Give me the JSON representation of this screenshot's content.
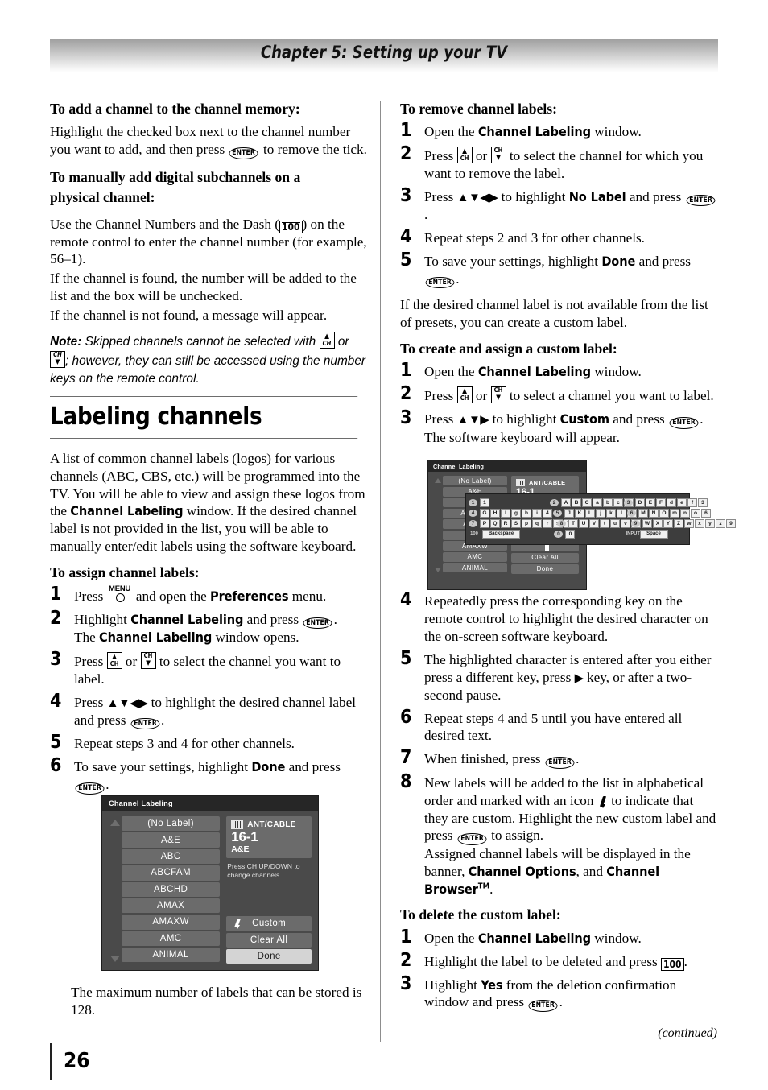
{
  "header": {
    "chapter_title": "Chapter 5: Setting up your TV"
  },
  "footer": {
    "continued": "(continued)",
    "page_number": "26"
  },
  "left_column": {
    "heading_add_channel": "To add a channel to the channel memory:",
    "para_add_channel_1": "Highlight the checked box next to the channel number",
    "para_add_channel_2": "you want to add, and then press",
    "para_add_channel_3": "to remove the tick.",
    "heading_manual_1": "To manually add digital subchannels on a",
    "heading_manual_2": "physical channel:",
    "para_manual_1": "Use the Channel Numbers and the Dash (",
    "para_manual_2": ") on",
    "para_manual_3": "the remote control to enter the channel number (for",
    "para_manual_4": "example, 56–1).",
    "para_manual_5": "If the channel is found, the number will be added to",
    "para_manual_6": "the list and the box will be unchecked.",
    "para_manual_7": "If the channel is not found, a message will appear.",
    "note_label": "Note:",
    "note_text_1": "Skipped channels cannot be selected with",
    "note_text_2": "or",
    "note_text_3": "; however, they can still be accessed",
    "note_text_4": "using the number keys on the remote control.",
    "section_title": "Labeling channels",
    "para_intro_1": "A list of common channel labels (logos) for various",
    "para_intro_2": "channels (ABC, CBS, etc.) will be programmed into",
    "para_intro_3": "the TV. You will be able to view and assign these",
    "para_intro_4": "logos from the",
    "para_intro_5": "window. If the",
    "para_intro_6": "desired channel label is not provided in the list, you",
    "para_intro_7": "will be able to manually enter/edit labels using the",
    "para_intro_8": "software keyboard.",
    "heading_assign": "To assign channel labels:",
    "assign_steps": [
      {
        "num": "1",
        "t1": "Press",
        "t2": "and open the",
        "bold": "Preferences",
        "t3": "menu."
      },
      {
        "num": "2",
        "t1": "Highlight",
        "bold": "Channel Labeling",
        "t2": "and press",
        "t3": ".",
        "l2a": "The",
        "l2bold": "Channel Labeling",
        "l2b": "window opens."
      },
      {
        "num": "3",
        "t1": "Press",
        "t2": "or",
        "t3": "to select the channel you want to",
        "t4": "label."
      },
      {
        "num": "4",
        "t1": "Press",
        "arrows": "▲▼◀▶",
        "t2": "to highlight the desired channel",
        "t3": "label and press",
        "t4": "."
      },
      {
        "num": "5",
        "t1": "Repeat steps 3 and 4 for other channels."
      },
      {
        "num": "6",
        "t1": "To save your settings, highlight",
        "bold": "Done",
        "t2": "and press",
        "t3": "."
      }
    ],
    "osd_caption_1": "The maximum number of labels that can be stored",
    "osd_caption_2": "is 128."
  },
  "right_column": {
    "heading_remove": "To remove channel labels:",
    "remove_steps": [
      {
        "num": "1",
        "t1": "Open the",
        "bold": "Channel Labeling",
        "t2": "window."
      },
      {
        "num": "2",
        "t1": "Press",
        "t2": "or",
        "t3": "to select the channel for which",
        "t4": "you want to remove the label."
      },
      {
        "num": "3",
        "t1": "Press",
        "arrows": "▲▼◀▶",
        "t2": "to highlight",
        "bold": "No Label",
        "t3": "and press",
        "t4": "."
      },
      {
        "num": "4",
        "t1": "Repeat steps 2 and 3 for other channels."
      },
      {
        "num": "5",
        "t1": "To save your settings, highlight",
        "bold": "Done",
        "t2": "and press",
        "t3": "."
      }
    ],
    "para_presets_1": "If the desired channel label is not available from the",
    "para_presets_2": "list of presets, you can create a custom label.",
    "heading_create": "To create and assign a custom label:",
    "create_steps": [
      {
        "num": "1",
        "t1": "Open the",
        "bold": "Channel Labeling",
        "t2": "window."
      },
      {
        "num": "2",
        "t1": "Press",
        "t2": "or",
        "t3": "to select a channel you want to",
        "t4": "label."
      },
      {
        "num": "3",
        "t1": "Press",
        "arrows": "▲▼▶",
        "t2": "to highlight",
        "bold": "Custom",
        "t3": "and press",
        "t4": ".",
        "l2": "The software keyboard will appear."
      }
    ],
    "create_steps_2": [
      {
        "num": "4",
        "t1": "Repeatedly press the corresponding key on the remote control to highlight the desired character on the on-screen software keyboard."
      },
      {
        "num": "5",
        "t1": "The highlighted character is entered after you either press a different key, press",
        "arrows": "▶",
        "t2": "key, or after a two-second pause."
      },
      {
        "num": "6",
        "t1": "Repeat steps 4 and 5 until you have entered all desired text."
      },
      {
        "num": "7",
        "t1": "When finished, press",
        "t2": "."
      },
      {
        "num": "8",
        "t1": "New labels will be added to the list in alphabetical order and marked with an icon",
        "t2": "to indicate that they are custom. Highlight the new custom label and press",
        "t3": "to assign.",
        "l2a": "Assigned channel labels will be displayed in the banner,",
        "l2bold1": "Channel Options",
        "l2b": ", and",
        "l2bold2": "Channel Browser",
        "l2tm": "TM",
        "l2c": "."
      }
    ],
    "heading_delete": "To delete the custom label:",
    "delete_steps": [
      {
        "num": "1",
        "t1": "Open the",
        "bold": "Channel Labeling",
        "t2": "window."
      },
      {
        "num": "2",
        "t1": "Highlight the label to be deleted and press",
        "t2": "."
      },
      {
        "num": "3",
        "t1": "Highlight",
        "bold": "Yes",
        "t2": "from the deletion confirmation",
        "t3": "window and press",
        "t4": "."
      }
    ]
  },
  "osd": {
    "title": "Channel Labeling",
    "list_items": [
      "(No Label)",
      "A&E",
      "ABC",
      "ABCFAM",
      "ABCHD",
      "AMAX",
      "AMAXW",
      "AMC",
      "ANIMAL"
    ],
    "source_label": "ANT/CABLE",
    "channel_number": "16-1",
    "channel_label": "A&E",
    "hint_line_1": "Press CH UP/DOWN to",
    "hint_line_2": "change channels.",
    "button_custom": "Custom",
    "button_clear_all": "Clear All",
    "button_done": "Done",
    "colors": {
      "panel_bg": "#4a4a4a",
      "title_bar": "#262626",
      "item_bg": "#6b6b6b",
      "done_bg": "#d4d4d4"
    }
  },
  "keyboard": {
    "rows": [
      {
        "key": "1",
        "cells": [
          "1"
        ]
      },
      {
        "key": "2",
        "cells": [
          "A",
          "B",
          "C",
          "a",
          "b",
          "c",
          "2"
        ]
      },
      {
        "key": "3",
        "cells": [
          "D",
          "E",
          "F",
          "d",
          "e",
          "f",
          "3"
        ]
      },
      {
        "key": "4",
        "cells": [
          "G",
          "H",
          "I",
          "g",
          "h",
          "i",
          "4"
        ]
      },
      {
        "key": "5",
        "cells": [
          "J",
          "K",
          "L",
          "j",
          "k",
          "l",
          "5"
        ]
      },
      {
        "key": "6",
        "cells": [
          "M",
          "N",
          "O",
          "m",
          "n",
          "o",
          "6"
        ]
      },
      {
        "key": "7",
        "cells": [
          "P",
          "Q",
          "R",
          "S",
          "p",
          "q",
          "r",
          "s",
          "7"
        ]
      },
      {
        "key": "8",
        "cells": [
          "T",
          "U",
          "V",
          "t",
          "u",
          "v",
          "8"
        ]
      },
      {
        "key": "9",
        "cells": [
          "W",
          "X",
          "Y",
          "Z",
          "w",
          "x",
          "y",
          "z",
          "9"
        ]
      },
      {
        "key": "100",
        "cells": [
          "Backspace"
        ]
      },
      {
        "key": "0",
        "cells": [
          "0"
        ]
      },
      {
        "key": "INPUT",
        "cells": [
          "Space"
        ]
      }
    ]
  },
  "icons": {
    "enter": "ENTER",
    "hundred": "100",
    "ch_up": "CH",
    "ch_down": "CH",
    "menu": "MENU"
  }
}
